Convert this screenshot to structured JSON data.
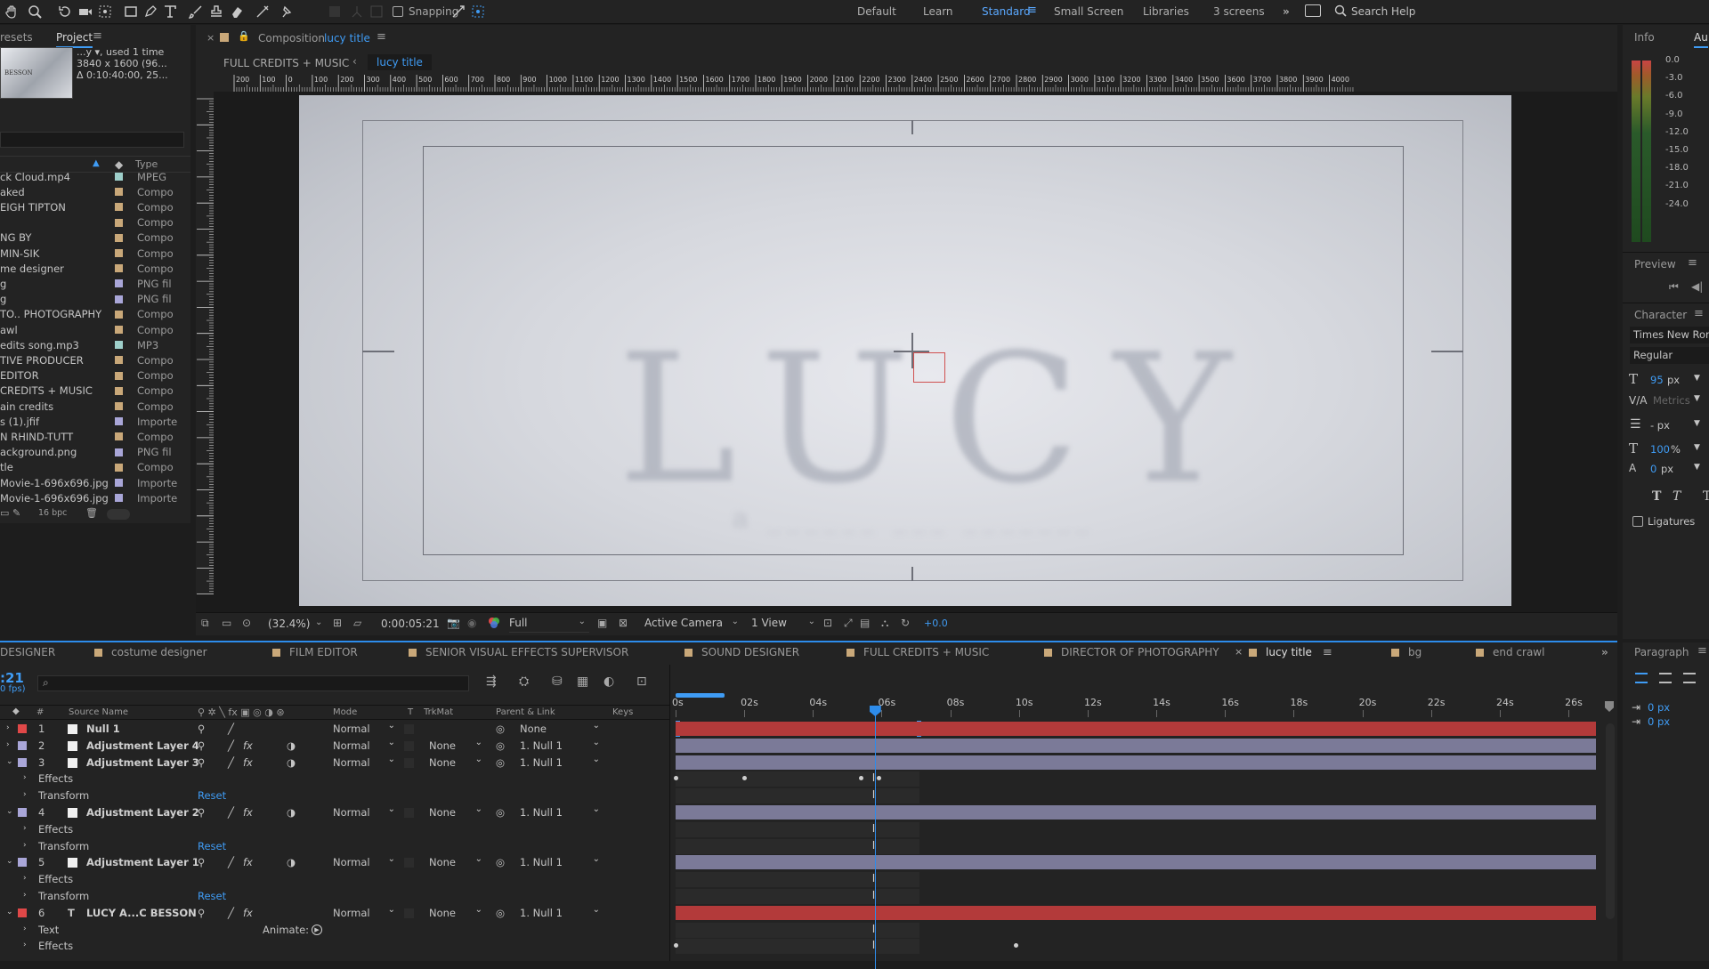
{
  "toolbar": {
    "snapping_label": "Snapping",
    "workspaces": [
      "Default",
      "Learn",
      "Standard",
      "Small Screen",
      "Libraries",
      "3 screens"
    ],
    "search_placeholder": "Search Help"
  },
  "project": {
    "tabs": [
      "resets",
      "Project"
    ],
    "info_line1": "...y ▾, used 1 time",
    "info_line2": "3840 x 1600  (96...",
    "info_line3": "Δ 0:10:40:00, 25...",
    "thumb_text": "BESSON",
    "type_header": "Type",
    "bpc": "16 bpc",
    "items": [
      {
        "name": "ck Cloud.mp4",
        "type": "MPEG",
        "color": "#9ecfca"
      },
      {
        "name": "aked",
        "type": "Compo",
        "color": "#c9a879"
      },
      {
        "name": "EIGH TIPTON",
        "type": "Compo",
        "color": "#c9a879"
      },
      {
        "name": "",
        "type": "Compo",
        "color": "#c9a879"
      },
      {
        "name": "NG BY",
        "type": "Compo",
        "color": "#c9a879"
      },
      {
        "name": "MIN-SIK",
        "type": "Compo",
        "color": "#c9a879"
      },
      {
        "name": "me designer",
        "type": "Compo",
        "color": "#c9a879"
      },
      {
        "name": "g",
        "type": "PNG fil",
        "color": "#a9a6d8"
      },
      {
        "name": "g",
        "type": "PNG fil",
        "color": "#a9a6d8"
      },
      {
        "name": "TO.. PHOTOGRAPHY",
        "type": "Compo",
        "color": "#c9a879"
      },
      {
        "name": "awl",
        "type": "Compo",
        "color": "#c9a879"
      },
      {
        "name": "edits song.mp3",
        "type": "MP3",
        "color": "#9ecfca"
      },
      {
        "name": "TIVE PRODUCER",
        "type": "Compo",
        "color": "#c9a879"
      },
      {
        "name": "EDITOR",
        "type": "Compo",
        "color": "#c9a879"
      },
      {
        "name": "CREDITS + MUSIC",
        "type": "Compo",
        "color": "#c9a879"
      },
      {
        "name": "ain credits",
        "type": "Compo",
        "color": "#c9a879"
      },
      {
        "name": "s (1).jfif",
        "type": "Importe",
        "color": "#a9a6d8"
      },
      {
        "name": "N RHIND-TUTT",
        "type": "Compo",
        "color": "#c9a879"
      },
      {
        "name": "ackground.png",
        "type": "PNG fil",
        "color": "#a9a6d8"
      },
      {
        "name": "tle",
        "type": "Compo",
        "color": "#c9a879"
      },
      {
        "name": "Movie-1-696x696.jpg",
        "type": "Importe",
        "color": "#a9a6d8"
      },
      {
        "name": "Movie-1-696x696.jpg",
        "type": "Importe",
        "color": "#a9a6d8"
      }
    ]
  },
  "composition": {
    "panel_label": "Composition",
    "name": "lucy title",
    "breadcrumb_parent": "FULL CREDITS + MUSIC",
    "breadcrumb_current": "lucy title",
    "ruler_labels": [
      "200",
      "100",
      "0",
      "100",
      "200",
      "300",
      "400",
      "500",
      "600",
      "700",
      "800",
      "900",
      "1000",
      "1100",
      "1200",
      "1300",
      "1400",
      "1500",
      "1600",
      "1700",
      "1800",
      "1900",
      "2000",
      "2100",
      "2200",
      "2300",
      "2400",
      "2500",
      "2600",
      "2700",
      "2800",
      "2900",
      "3000",
      "3100",
      "3200",
      "3300",
      "3400",
      "3500",
      "3600",
      "3700",
      "3800",
      "3900",
      "4000"
    ],
    "canvas_title": "LUCY",
    "canvas_subtitle": "a ______ ___ _______",
    "zoom": "(32.4%)",
    "timecode": "0:00:05:21",
    "resolution": "Full",
    "camera": "Active Camera",
    "views": "1 View",
    "exposure": "+0.0"
  },
  "info": {
    "tab_info": "Info",
    "tab_audio": "Au",
    "db_labels": [
      "0.0",
      "-3.0",
      "-6.0",
      "-9.0",
      "-12.0",
      "-15.0",
      "-18.0",
      "-21.0",
      "-24.0"
    ],
    "preview_label": "Preview",
    "character_label": "Character",
    "font": "Times New Roman",
    "style": "Regular",
    "size": "95",
    "size_unit": "px",
    "kerning": "Metrics",
    "leading": "- px",
    "vscale": "100",
    "vscale_unit": "%",
    "baseline": "0",
    "baseline_unit": "px",
    "t_bold": "T",
    "t_italic": "T",
    "ligatures": "Ligatures",
    "paragraph_label": "Paragraph",
    "indent_val": "0 px",
    "indent_val2": "0 px"
  },
  "timeline": {
    "tabs": [
      "DESIGNER",
      "costume designer",
      "FILM EDITOR",
      "SENIOR VISUAL EFFECTS SUPERVISOR",
      "SOUND DESIGNER",
      "FULL CREDITS + MUSIC",
      "DIRECTOR OF PHOTOGRAPHY",
      "lucy title",
      "bg",
      "end crawl"
    ],
    "active_tab": "lucy title",
    "timecode": ":21",
    "fps": "0 fps)",
    "search_placeholder": "",
    "headers": {
      "num": "#",
      "source": "Source Name",
      "mode": "Mode",
      "t": "T",
      "trkmat": "TrkMat",
      "parent": "Parent & Link",
      "keys": "Keys"
    },
    "time_labels": [
      "0s",
      "02s",
      "04s",
      "06s",
      "08s",
      "10s",
      "12s",
      "14s",
      "16s",
      "18s",
      "20s",
      "22s",
      "24s",
      "26s"
    ],
    "current_time_sec": 5.8,
    "work_area_end_sec": 7.1,
    "duration_sec": 26.8,
    "layers": [
      {
        "num": "1",
        "name": "Null 1",
        "color": "#e04848",
        "mode": "Normal",
        "trkmat": "",
        "parent": "None",
        "bar": "#b33a3a",
        "expanded": false
      },
      {
        "num": "2",
        "name": "Adjustment Layer 4",
        "color": "#a9a6d8",
        "mode": "Normal",
        "trkmat": "None",
        "parent": "1. Null 1",
        "bar": "#7b7a98",
        "expanded": false
      },
      {
        "num": "3",
        "name": "Adjustment Layer 3",
        "color": "#a9a6d8",
        "mode": "Normal",
        "trkmat": "None",
        "parent": "1. Null 1",
        "bar": "#7b7a98",
        "expanded": true
      },
      {
        "num": "4",
        "name": "Adjustment Layer 2",
        "color": "#a9a6d8",
        "mode": "Normal",
        "trkmat": "None",
        "parent": "1. Null 1",
        "bar": "#7b7a98",
        "expanded": true
      },
      {
        "num": "5",
        "name": "Adjustment Layer 1",
        "color": "#a9a6d8",
        "mode": "Normal",
        "trkmat": "None",
        "parent": "1. Null 1",
        "bar": "#7b7a98",
        "expanded": true
      },
      {
        "num": "6",
        "name": "LUCY A...C BESSON",
        "color": "#e04848",
        "mode": "Normal",
        "trkmat": "None",
        "parent": "1. Null 1",
        "bar": "#b33a3a",
        "expanded": true
      }
    ],
    "sub_effects": "Effects",
    "sub_transform": "Transform",
    "sub_text": "Text",
    "reset": "Reset",
    "animate": "Animate:"
  }
}
